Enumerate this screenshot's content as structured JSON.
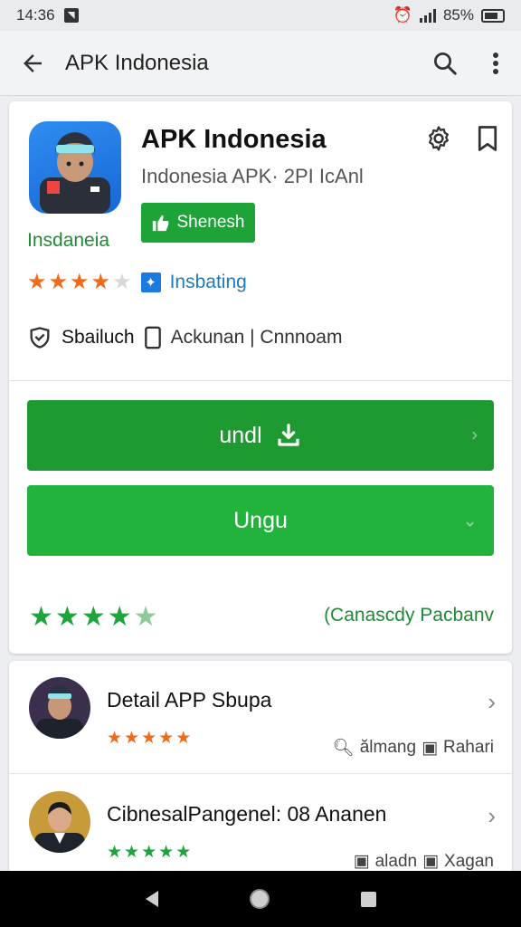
{
  "status_bar": {
    "time": "14:36",
    "battery": "85%"
  },
  "app_bar": {
    "title": "APK Indonesia"
  },
  "app": {
    "name": "APK Indonesia",
    "subtitle": "Indonesia APK· 2PI IcAnl",
    "share_label": "Shenesh",
    "developer": "Insdaneia",
    "rating_stars": 4,
    "rating_max": 5,
    "rating_label": "Insbating",
    "meta_author": "Sbailuch",
    "meta_info": "Ackunan | Cnnnoam"
  },
  "buttons": {
    "primary": "undl",
    "secondary": "Ungu"
  },
  "bottom": {
    "rating_stars": 4,
    "rating_max": 5,
    "link": "(Canascdy Pacbanv"
  },
  "list": [
    {
      "title": "Detail APP Sbupa",
      "stars": 5,
      "meta_a": "ălmang",
      "meta_b": "Rahari"
    },
    {
      "title": "CibnesalPangenel: 08 Ananen",
      "stars": 5,
      "meta_a": "aladn",
      "meta_b": "Xagan"
    }
  ],
  "colors": {
    "primary_green": "#1f9a33",
    "accent_orange": "#f06a1c",
    "link_blue": "#1a7bbf"
  }
}
